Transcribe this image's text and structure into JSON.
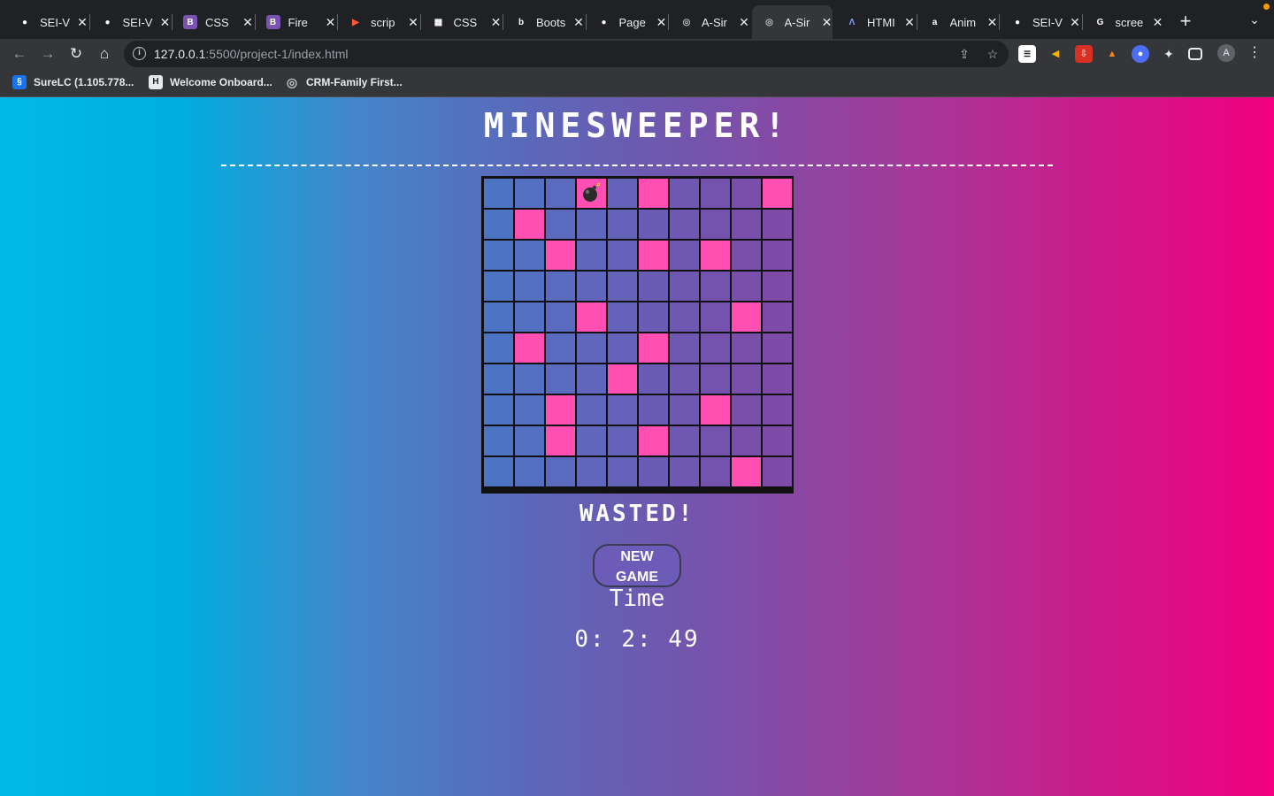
{
  "browser": {
    "tabs": [
      {
        "title": "SEI-V",
        "icon": "github-icon",
        "color": "#ffffff"
      },
      {
        "title": "SEI-V",
        "icon": "github-icon",
        "color": "#ffffff"
      },
      {
        "title": "CSS",
        "icon": "bootstrap-icon",
        "color": "#7952b3"
      },
      {
        "title": "Fire",
        "icon": "bootstrap-icon",
        "color": "#7952b3"
      },
      {
        "title": "scrip",
        "icon": "scrimba-icon",
        "color": "#ff5b2e"
      },
      {
        "title": "CSS",
        "icon": "building-icon",
        "color": "#ffffff"
      },
      {
        "title": "Boots",
        "icon": "bing-icon",
        "color": "#ffffff"
      },
      {
        "title": "Page",
        "icon": "github-icon",
        "color": "#ffffff"
      },
      {
        "title": "A-Sir",
        "icon": "globe-icon",
        "color": "#bdc1c6"
      },
      {
        "title": "A-Sir",
        "icon": "globe-icon",
        "color": "#bdc1c6",
        "active": true
      },
      {
        "title": "HTMI",
        "icon": "lambda-icon",
        "color": "#8a9bff"
      },
      {
        "title": "Anim",
        "icon": "amazon-icon",
        "color": "#ffffff"
      },
      {
        "title": "SEI-V",
        "icon": "github-icon",
        "color": "#ffffff"
      },
      {
        "title": "scree",
        "icon": "google-icon",
        "color": "#ffffff"
      }
    ],
    "url_host": "127.0.0.1",
    "url_rest": ":5500/project-1/index.html",
    "bookmarks": [
      {
        "label": "SureLC (1.105.778...",
        "icon": "surelc-icon",
        "color": "#1a73e8"
      },
      {
        "label": "Welcome Onboard...",
        "icon": "h-icon",
        "color": "#202124"
      },
      {
        "label": "CRM-Family First...",
        "icon": "globe-icon",
        "color": "#5f6368"
      }
    ],
    "profile_initial": "A"
  },
  "game": {
    "title": "MINESWEEPER!",
    "status": "WASTED!",
    "new_game_label": "NEW GAME",
    "time_label": "Time",
    "time_value": "0: 2: 49",
    "grid_size": 10,
    "exploded_cell": [
      0,
      3
    ],
    "revealed_mines": [
      [
        0,
        3
      ],
      [
        0,
        5
      ],
      [
        0,
        9
      ],
      [
        1,
        1
      ],
      [
        2,
        2
      ],
      [
        2,
        5
      ],
      [
        2,
        7
      ],
      [
        4,
        3
      ],
      [
        4,
        8
      ],
      [
        5,
        1
      ],
      [
        5,
        5
      ],
      [
        6,
        4
      ],
      [
        7,
        2
      ],
      [
        7,
        7
      ],
      [
        8,
        2
      ],
      [
        8,
        5
      ],
      [
        9,
        8
      ]
    ],
    "colors": {
      "mine_cell": "#ff4fb3",
      "grid_line": "#111111"
    }
  }
}
